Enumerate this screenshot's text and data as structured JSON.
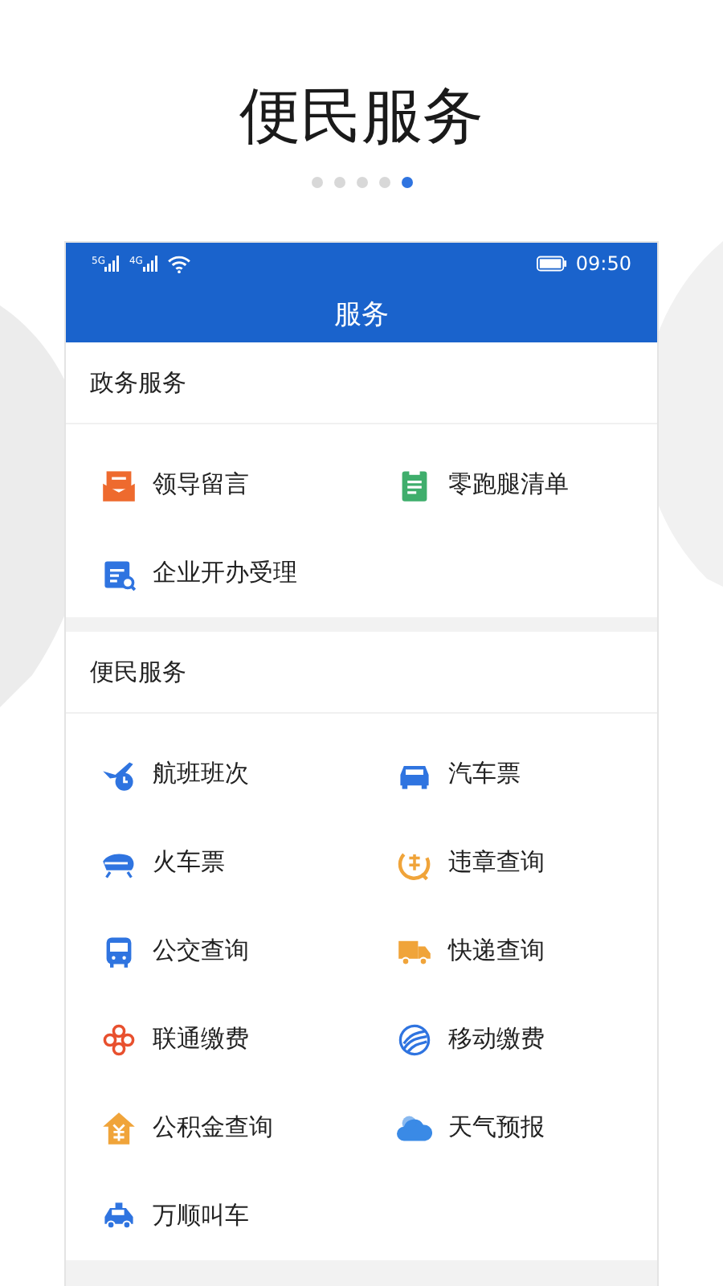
{
  "headline": "便民服务",
  "pager": [
    {
      "selected": false
    },
    {
      "selected": false
    },
    {
      "selected": false
    },
    {
      "selected": false
    },
    {
      "selected": true
    }
  ],
  "status_bar": {
    "signals": [
      "5G",
      "4G"
    ],
    "time": "09:50"
  },
  "app_bar": {
    "title": "服务"
  },
  "sections": [
    {
      "title": "政务服务",
      "items": [
        {
          "label": "领导留言",
          "kind": "mail",
          "color": "#ee6a2e"
        },
        {
          "label": "零跑腿清单",
          "kind": "clipboard",
          "color": "#3fae6c"
        },
        {
          "label": "企业开办受理",
          "kind": "form",
          "color": "#2f74e0"
        }
      ]
    },
    {
      "title": "便民服务",
      "items": [
        {
          "label": "航班班次",
          "kind": "plane",
          "color": "#2f74e0"
        },
        {
          "label": "汽车票",
          "kind": "car",
          "color": "#2f74e0"
        },
        {
          "label": "火车票",
          "kind": "train",
          "color": "#2f74e0"
        },
        {
          "label": "违章查询",
          "kind": "violation",
          "color": "#f0a43a"
        },
        {
          "label": "公交查询",
          "kind": "bus",
          "color": "#2f74e0"
        },
        {
          "label": "快递查询",
          "kind": "truck",
          "color": "#f0a43a"
        },
        {
          "label": "联通缴费",
          "kind": "knot",
          "color": "#e8502e"
        },
        {
          "label": "移动缴费",
          "kind": "swirl",
          "color": "#2f74e0"
        },
        {
          "label": "公积金查询",
          "kind": "house",
          "color": "#f0a43a"
        },
        {
          "label": "天气预报",
          "kind": "cloud",
          "color": "#3a8ae6"
        },
        {
          "label": "万顺叫车",
          "kind": "taxi",
          "color": "#2f74e0"
        }
      ]
    }
  ]
}
